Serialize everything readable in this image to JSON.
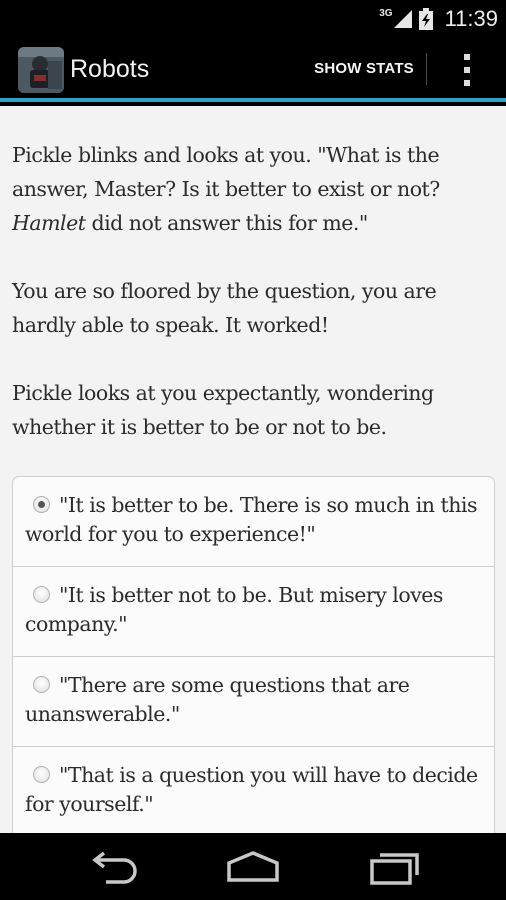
{
  "status_bar": {
    "network_type": "3G",
    "time": "11:39"
  },
  "action_bar": {
    "app_title": "Robots",
    "show_stats_label": "SHOW STATS",
    "accent_color": "#2fa0c9"
  },
  "story": {
    "paragraphs": [
      {
        "before": "Pickle blinks and looks at you. \"What is the answer, Master? Is it better to exist or not? ",
        "italic": "Hamlet",
        "after": " did not answer this for me.\""
      },
      {
        "text": "You are so floored by the question, you are hardly able to speak. It worked!"
      },
      {
        "text": "Pickle looks at you expectantly, wondering whether it is better to be or not to be."
      }
    ]
  },
  "choices": [
    {
      "text": "\"It is better to be. There is so much in this world for you to experience!\"",
      "selected": true
    },
    {
      "text": "\"It is better not to be. But misery loves company.\"",
      "selected": false
    },
    {
      "text": "\"There are some questions that are unanswerable.\"",
      "selected": false
    },
    {
      "text": "\"That is a question you will have to decide for yourself.\"",
      "selected": false
    }
  ],
  "nav_bar": {
    "icons": [
      "back-icon",
      "home-icon",
      "recent-apps-icon"
    ]
  }
}
